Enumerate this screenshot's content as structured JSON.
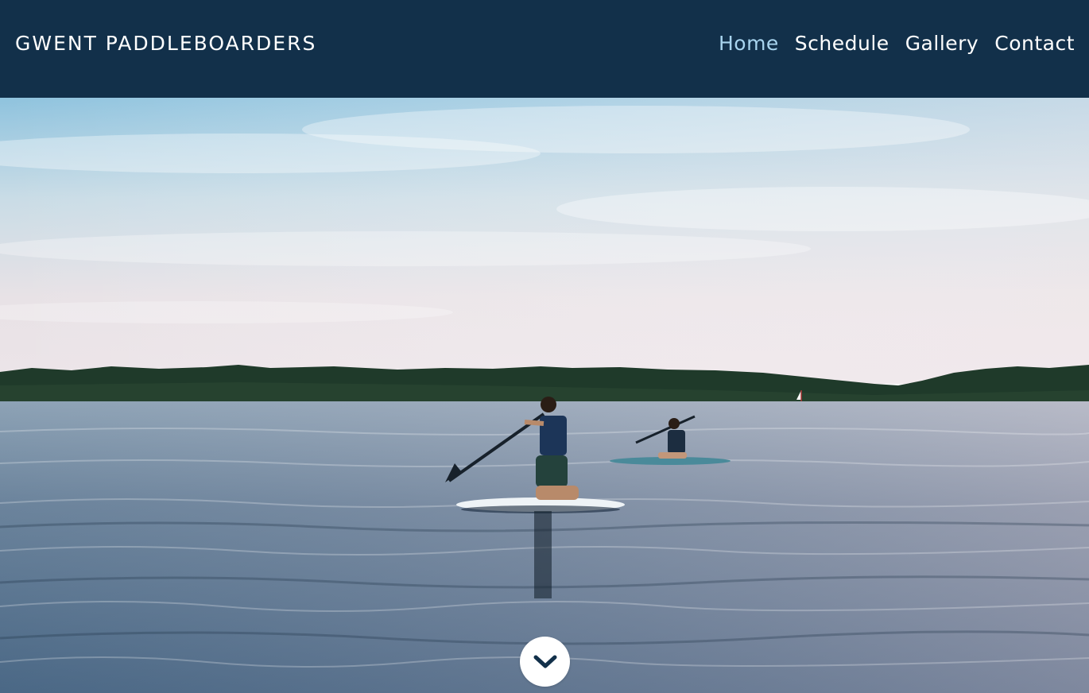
{
  "brand": {
    "name": "GWENT PADDLEBOARDERS"
  },
  "nav": {
    "items": [
      {
        "label": "Home",
        "active": true
      },
      {
        "label": "Schedule",
        "active": false
      },
      {
        "label": "Gallery",
        "active": false
      },
      {
        "label": "Contact",
        "active": false
      }
    ]
  },
  "hero": {
    "image_subject": "two paddleboarders kneeling on boards on a calm lake at dusk",
    "scroll_icon": "chevron-down-icon"
  },
  "colors": {
    "navbar_bg": "#12304a",
    "nav_text": "#ffffff",
    "nav_active": "#a8d4ee",
    "scroll_button_bg": "#ffffff",
    "scroll_chevron": "#12304a"
  }
}
